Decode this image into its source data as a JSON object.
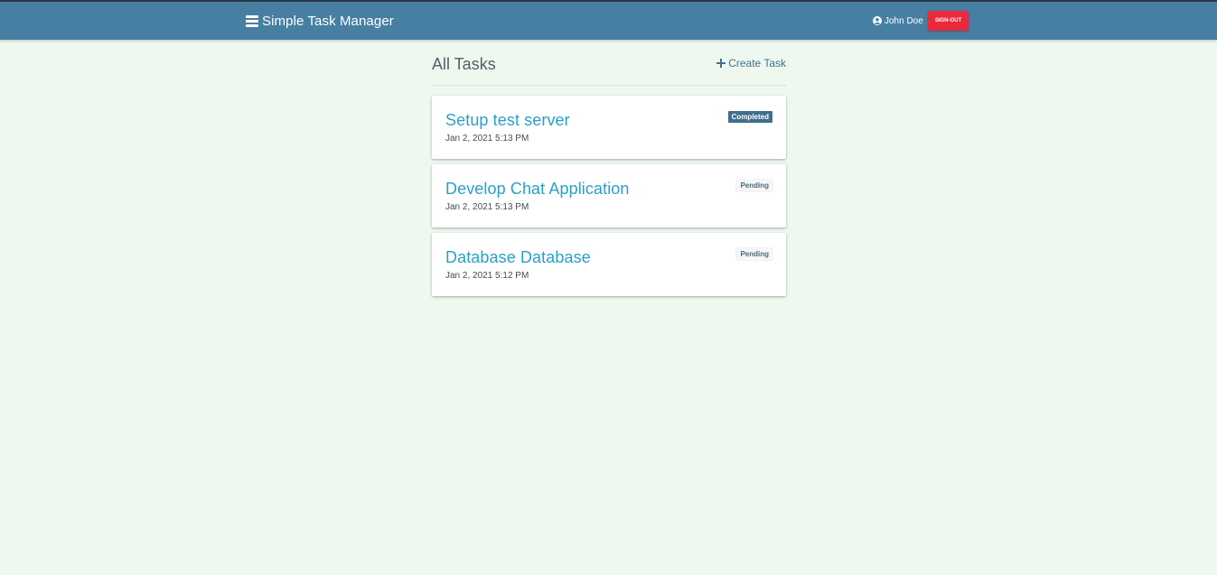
{
  "navbar": {
    "brand_title": "Simple Task Manager",
    "user_name": "John Doe",
    "signout_label": "SIGN-OUT",
    "colors": {
      "navbar_bg": "#477fa3",
      "signout_bg": "#ea2a3c"
    }
  },
  "main": {
    "title": "All Tasks",
    "create_label": "Create Task"
  },
  "tasks": [
    {
      "title": "Setup test server",
      "date": "Jan 2, 2021 5:13 PM",
      "status": "Completed"
    },
    {
      "title": "Develop Chat Application",
      "date": "Jan 2, 2021 5:13 PM",
      "status": "Pending"
    },
    {
      "title": "Database Database",
      "date": "Jan 2, 2021 5:12 PM",
      "status": "Pending"
    }
  ],
  "icons": {
    "brand": "menu-bars-icon",
    "user": "user-circle-icon",
    "create": "plus-icon"
  }
}
